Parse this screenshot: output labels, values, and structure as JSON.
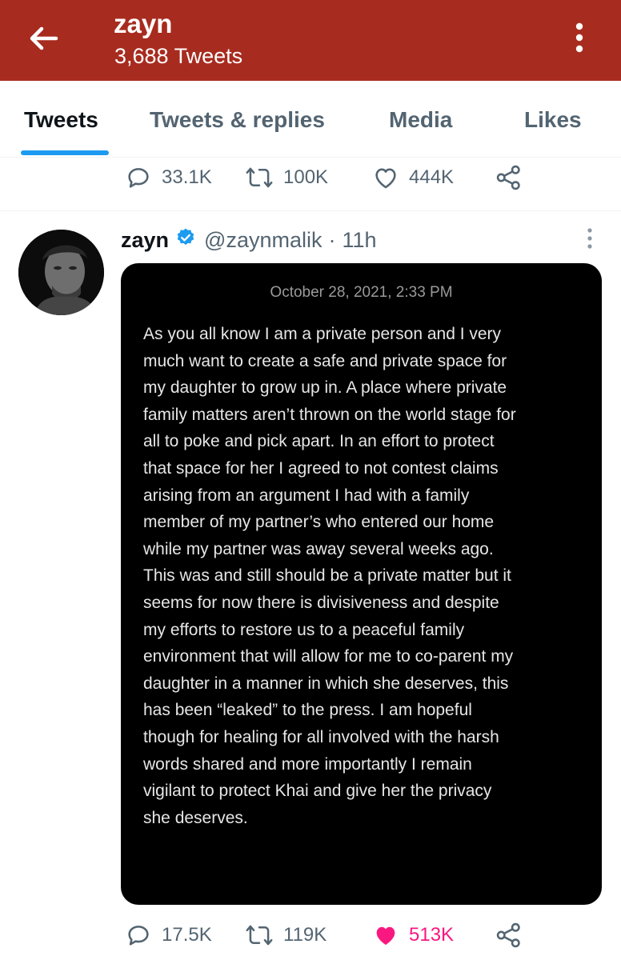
{
  "header": {
    "name": "zayn",
    "tweet_count": "3,688 Tweets",
    "background_color": "#a82b1f"
  },
  "tabs": [
    {
      "label": "Tweets",
      "active": true
    },
    {
      "label": "Tweets & replies",
      "active": false
    },
    {
      "label": "Media",
      "active": false
    },
    {
      "label": "Likes",
      "active": false
    }
  ],
  "previous_tweet_actions": {
    "replies": "33.1K",
    "retweets": "100K",
    "likes": "444K"
  },
  "tweet": {
    "author_name": "zayn",
    "handle": "@zaynmalik",
    "separator": "·",
    "time": "11h",
    "verified": true,
    "media": {
      "date": "October 28, 2021, 2:33 PM",
      "text": "As you all know I am a private person and I very\nmuch want to create a safe and private space for\nmy daughter to grow up in. A place where private\nfamily matters aren’t thrown on the world stage for\nall to poke and pick apart.  In an effort to protect\nthat space for her I agreed to not contest claims\narising from an argument I had with a family\nmember of my partner’s who entered our home\nwhile my partner was away several weeks ago.\nThis was and still should be a private matter but it\nseems for now there is divisiveness and despite\nmy efforts to restore us to a peaceful family\nenvironment that will allow for me to co-parent my\ndaughter in a manner in which she deserves, this\nhas been “leaked” to the press.  I am hopeful\nthough for healing for all involved with the harsh\nwords shared and more importantly I remain\nvigilant to protect Khai and give her the privacy\nshe deserves."
    },
    "actions": {
      "replies": "17.5K",
      "retweets": "119K",
      "likes": "513K",
      "liked": true
    }
  },
  "colors": {
    "accent": "#1d9bf0",
    "like": "#f91880",
    "muted": "#536471"
  },
  "icons": [
    "back-arrow-icon",
    "more-vertical-icon",
    "reply-icon",
    "retweet-icon",
    "heart-icon",
    "share-icon",
    "verified-icon"
  ]
}
